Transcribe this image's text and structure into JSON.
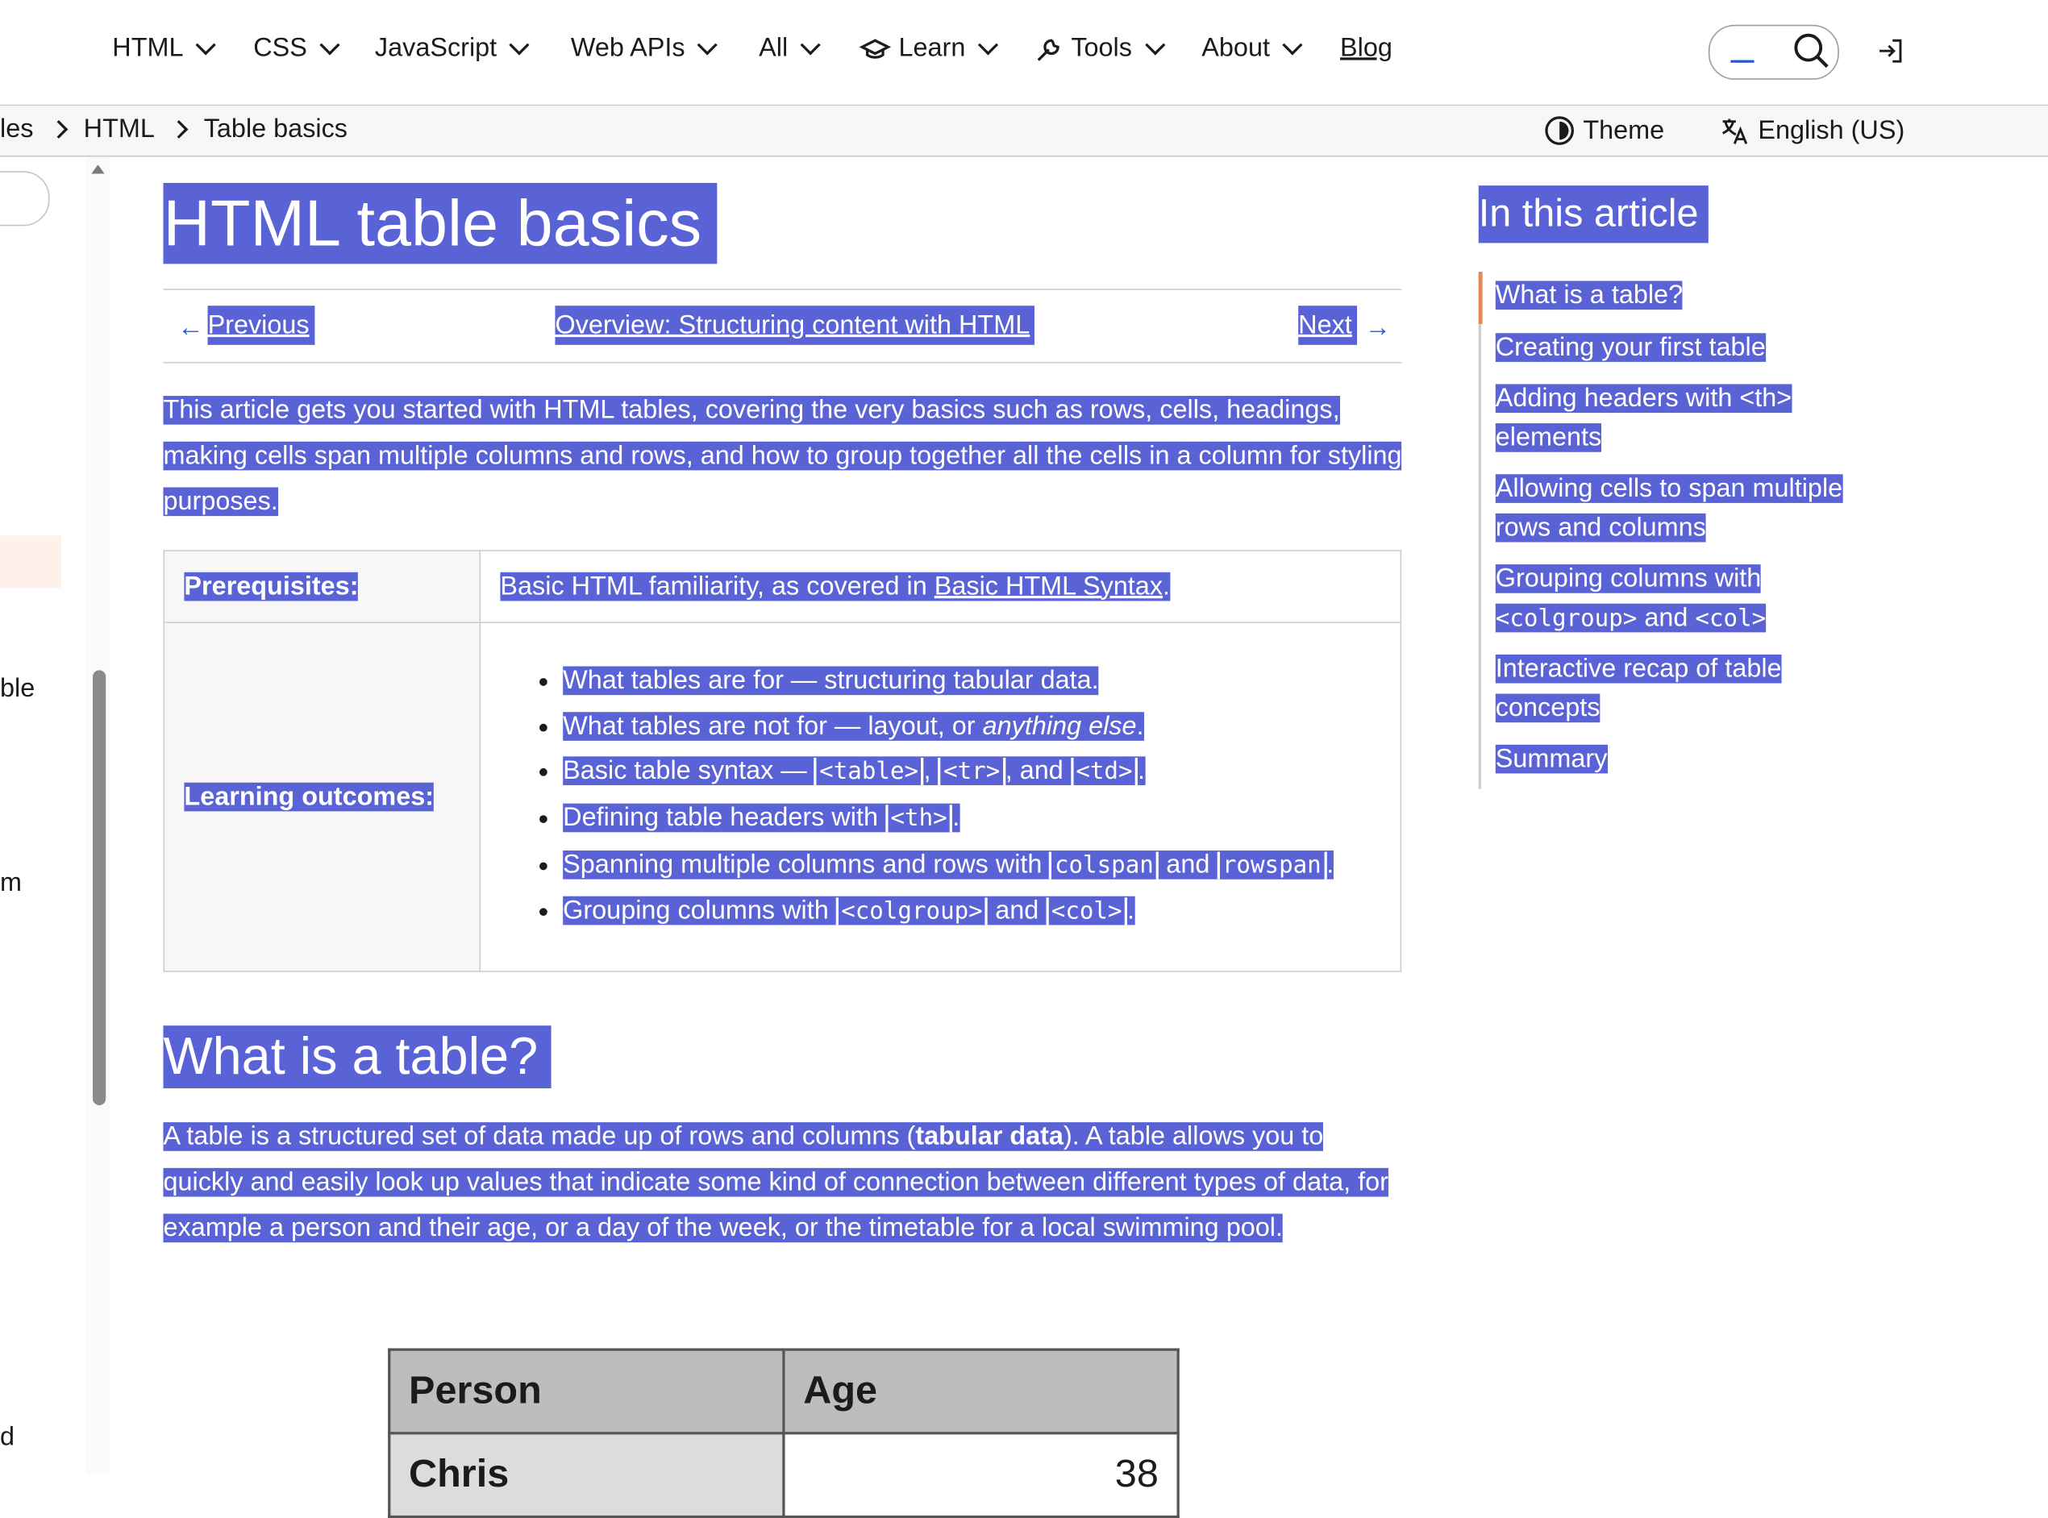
{
  "nav": {
    "items": [
      {
        "label": "HTML"
      },
      {
        "label": "CSS"
      },
      {
        "label": "JavaScript"
      },
      {
        "label": "Web APIs"
      },
      {
        "label": "All"
      },
      {
        "label": "Learn"
      },
      {
        "label": "Tools"
      },
      {
        "label": "About"
      }
    ],
    "blog": "Blog"
  },
  "breadcrumb": {
    "items": [
      "les",
      "HTML",
      "Table basics"
    ],
    "theme": "Theme",
    "language": "English (US)"
  },
  "sidebar": {
    "fragments": [
      "ble",
      "m",
      "d"
    ]
  },
  "article": {
    "title": "HTML table basics",
    "previous": "Previous",
    "overview": "Overview: Structuring content with HTML",
    "next": "Next",
    "intro": "This article gets you started with HTML tables, covering the very basics such as rows, cells, headings, making cells span multiple columns and rows, and how to group together all the cells in a column for styling purposes.",
    "prereq_label": "Prerequisites:",
    "prereq_text": "Basic HTML familiarity, as covered in ",
    "prereq_link": "Basic HTML Syntax",
    "prereq_end": ".",
    "outcomes_label": "Learning outcomes:",
    "outcomes": {
      "o1": "What tables are for — structuring tabular data.",
      "o2_a": "What tables are not for — layout, or ",
      "o2_em": "anything else",
      "o2_b": ".",
      "o3_a": "Basic table syntax — ",
      "o3_c1": "<table>",
      "o3_s1": ", ",
      "o3_c2": "<tr>",
      "o3_s2": ", and ",
      "o3_c3": "<td>",
      "o3_end": ".",
      "o4_a": "Defining table headers with ",
      "o4_c": "<th>",
      "o4_end": ".",
      "o5_a": "Spanning multiple columns and rows with ",
      "o5_c1": "colspan",
      "o5_s": " and ",
      "o5_c2": "rowspan",
      "o5_end": ".",
      "o6_a": "Grouping columns with ",
      "o6_c1": "<colgroup>",
      "o6_s": " and ",
      "o6_c2": "<col>",
      "o6_end": "."
    },
    "h2_what": "What is a table?",
    "what_a": "A table is a structured set of data made up of rows and columns (",
    "what_b": "tabular data",
    "what_c": "). A table allows you to quickly and easily look up values that indicate some kind of connection between different types of data, for example a person and their age, or a day of the week, or the timetable for a local swimming pool.",
    "example_table": {
      "headers": [
        "Person",
        "Age"
      ],
      "rows": [
        [
          "Chris",
          "38"
        ]
      ]
    }
  },
  "toc": {
    "title": "In this article",
    "items": {
      "i1": "What is a table?",
      "i2": "Creating your first table",
      "i3": "Adding headers with <th> elements",
      "i4": "Allowing cells to span multiple rows and columns",
      "i5_a": "Grouping columns with ",
      "i5_c1": "<colgroup>",
      "i5_s": " and ",
      "i5_c2": "<col>",
      "i6": "Interactive recap of table concepts",
      "i7": "Summary"
    }
  },
  "colors": {
    "selection": "#5a63d6",
    "toc_active": "#e28a58",
    "link": "#1c5bd6"
  }
}
